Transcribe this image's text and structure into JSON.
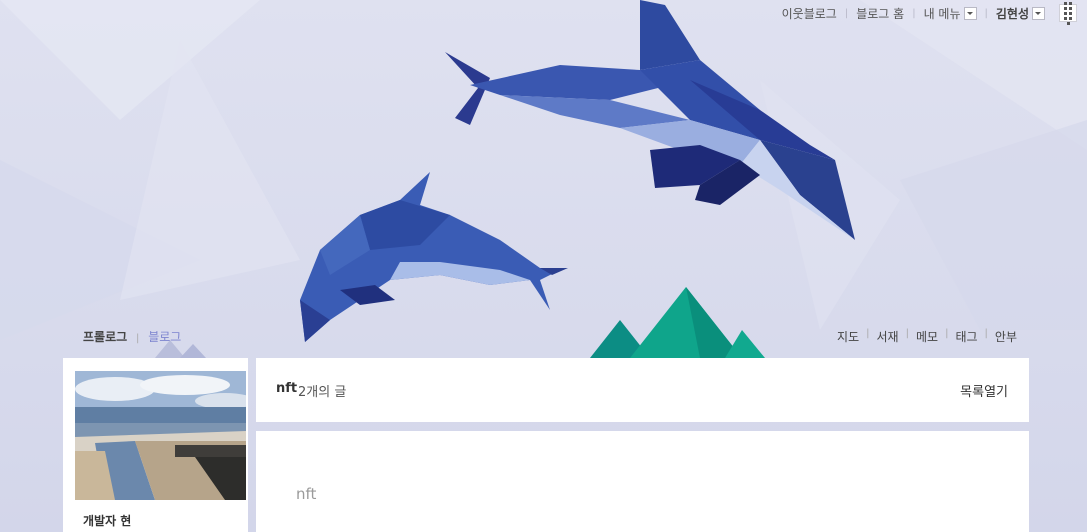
{
  "topnav": {
    "neighbor_blog": "이웃블로그",
    "blog_home": "블로그 홈",
    "my_menu": "내 메뉴",
    "user_name": "김현성"
  },
  "left_tabs": {
    "prologue": "프롤로그",
    "blog": "블로그"
  },
  "right_tabs": {
    "map": "지도",
    "library": "서재",
    "memo": "메모",
    "tag": "태그",
    "guestbook": "안부"
  },
  "profile": {
    "nickname": "개발자 현"
  },
  "list_bar": {
    "category": "nft",
    "post_count": "2개의 글",
    "toggle_label": "목록열기"
  },
  "post": {
    "category": "nft",
    "title_partial": ""
  },
  "colors": {
    "accent": "#7d84cf",
    "background": "#dadcee",
    "dolphin_dark": "#1e2a78",
    "dolphin_mid": "#3b5fb5",
    "mountain": "#0fa58b"
  }
}
